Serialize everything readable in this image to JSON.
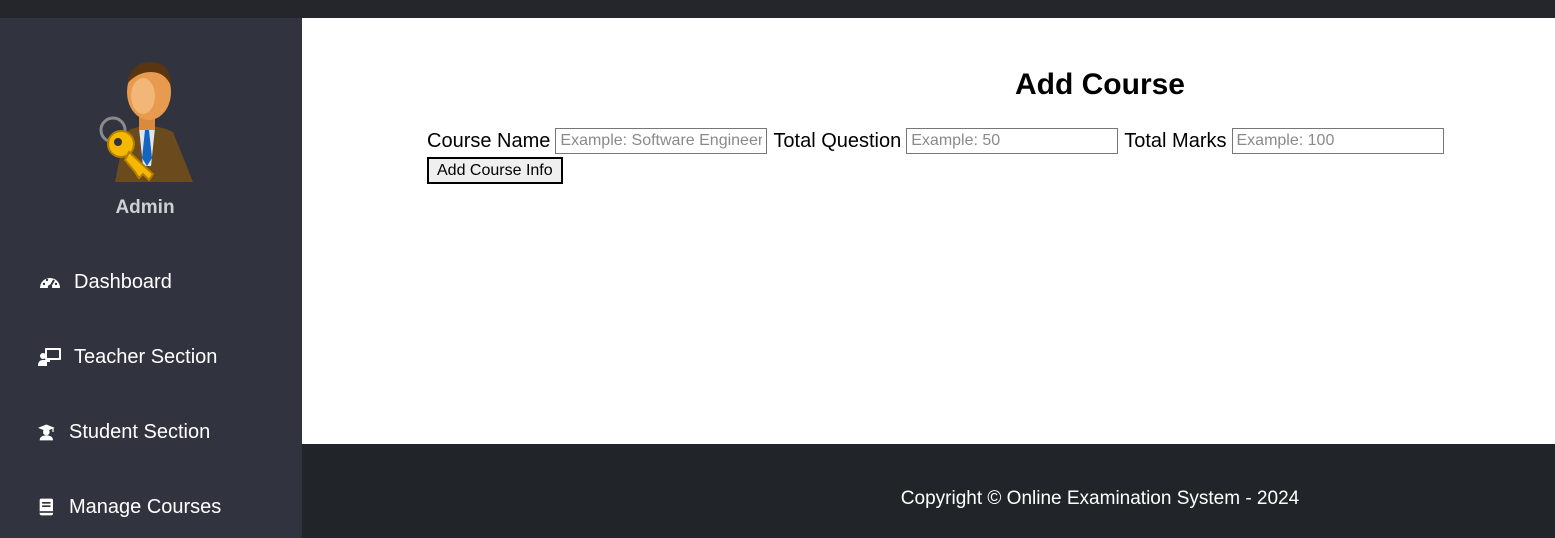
{
  "sidebar": {
    "user_name": "Admin",
    "items": [
      {
        "label": "Dashboard",
        "icon": "gauge-icon"
      },
      {
        "label": "Teacher Section",
        "icon": "teacher-icon"
      },
      {
        "label": "Student Section",
        "icon": "graduate-icon"
      },
      {
        "label": "Manage Courses",
        "icon": "book-icon"
      }
    ]
  },
  "main": {
    "title": "Add Course",
    "form": {
      "course_name_label": "Course Name",
      "course_name_placeholder": "Example: Software Engineering",
      "total_question_label": "Total Question",
      "total_question_placeholder": "Example: 50",
      "total_marks_label": "Total Marks",
      "total_marks_placeholder": "Example: 100",
      "submit_label": "Add Course Info"
    }
  },
  "footer": {
    "text": "Copyright © Online Examination System - 2024"
  },
  "colors": {
    "sidebar_bg": "#31343e",
    "footer_bg": "#212529",
    "main_bg": "#ffffff"
  }
}
